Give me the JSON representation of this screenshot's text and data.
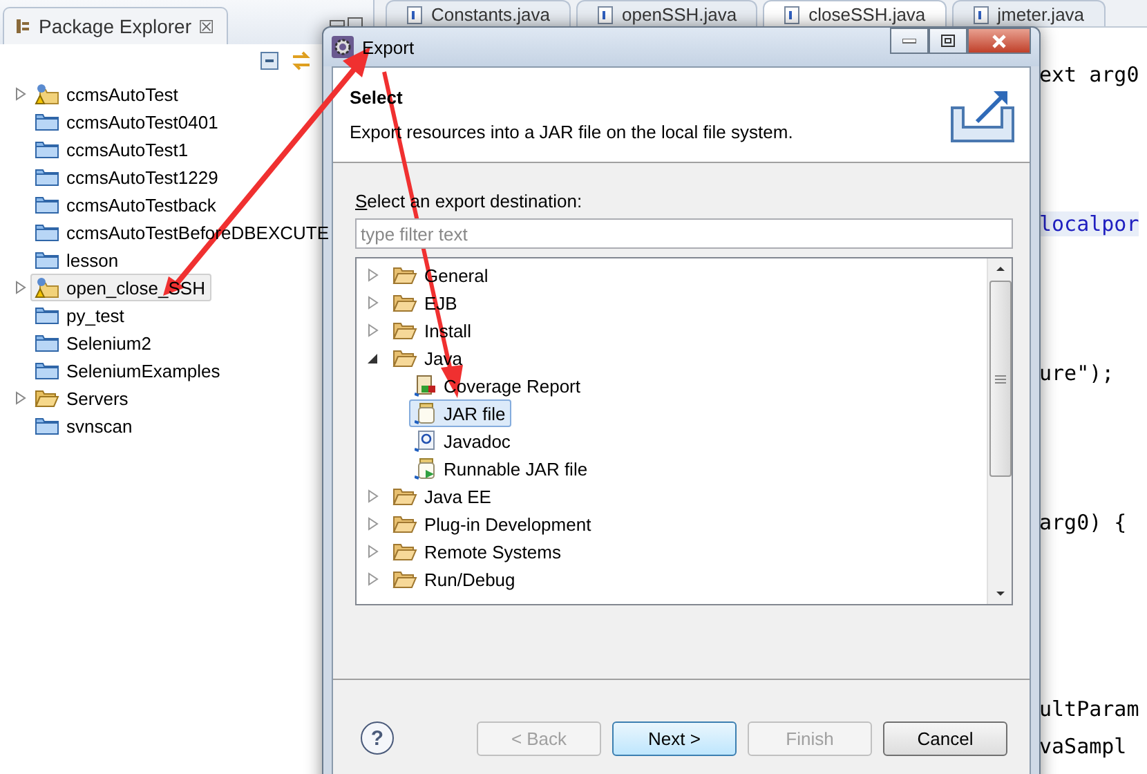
{
  "package_explorer": {
    "title": "Package Explorer",
    "close": "☒",
    "items": [
      {
        "label": "ccmsAutoTest",
        "kind": "project",
        "expandable": true,
        "selected": false
      },
      {
        "label": "ccmsAutoTest0401",
        "kind": "folder",
        "expandable": false,
        "selected": false
      },
      {
        "label": "ccmsAutoTest1",
        "kind": "folder",
        "expandable": false,
        "selected": false
      },
      {
        "label": "ccmsAutoTest1229",
        "kind": "folder",
        "expandable": false,
        "selected": false
      },
      {
        "label": "ccmsAutoTestback",
        "kind": "folder",
        "expandable": false,
        "selected": false
      },
      {
        "label": "ccmsAutoTestBeforeDBEXCUTE",
        "kind": "folder",
        "expandable": false,
        "selected": false
      },
      {
        "label": "lesson",
        "kind": "folder",
        "expandable": false,
        "selected": false
      },
      {
        "label": "open_close_SSH",
        "kind": "project",
        "expandable": true,
        "selected": true
      },
      {
        "label": "py_test",
        "kind": "folder",
        "expandable": false,
        "selected": false
      },
      {
        "label": "Selenium2",
        "kind": "folder",
        "expandable": false,
        "selected": false
      },
      {
        "label": "SeleniumExamples",
        "kind": "folder",
        "expandable": false,
        "selected": false
      },
      {
        "label": "Servers",
        "kind": "open-folder",
        "expandable": true,
        "selected": false
      },
      {
        "label": "svnscan",
        "kind": "folder",
        "expandable": false,
        "selected": false
      }
    ]
  },
  "editor": {
    "tabs": [
      {
        "label": "Constants.java",
        "selected": false
      },
      {
        "label": "openSSH.java",
        "selected": false
      },
      {
        "label": "closeSSH.java",
        "selected": true
      },
      {
        "label": "jmeter.java",
        "selected": false
      }
    ],
    "code_lines": [
      {
        "text": "ext arg0",
        "highlighted": false
      },
      {
        "text": "localpor",
        "highlighted": true
      },
      {
        "text": "ure\");",
        "highlighted": false
      },
      {
        "text": "arg0) {",
        "highlighted": false
      },
      {
        "text": "ultParam",
        "highlighted": false
      },
      {
        "text": "vaSampl",
        "highlighted": false
      }
    ]
  },
  "dialog": {
    "title": "Export",
    "header": {
      "title": "Select",
      "description": "Export resources into a JAR file on the local file system."
    },
    "destination_label": "Select an export destination:",
    "filter": {
      "placeholder": "type filter text"
    },
    "tree": [
      {
        "label": "General",
        "expanded": false,
        "selected": false
      },
      {
        "label": "EJB",
        "expanded": false,
        "selected": false
      },
      {
        "label": "Install",
        "expanded": false,
        "selected": false
      },
      {
        "label": "Java",
        "expanded": true,
        "selected": false,
        "children": [
          {
            "label": "Coverage Report",
            "kind": "coverage",
            "selected": false
          },
          {
            "label": "JAR file",
            "kind": "jar",
            "selected": true
          },
          {
            "label": "Javadoc",
            "kind": "javadoc",
            "selected": false
          },
          {
            "label": "Runnable JAR file",
            "kind": "runnable",
            "selected": false
          }
        ]
      },
      {
        "label": "Java EE",
        "expanded": false,
        "selected": false
      },
      {
        "label": "Plug-in Development",
        "expanded": false,
        "selected": false
      },
      {
        "label": "Remote Systems",
        "expanded": false,
        "selected": false
      },
      {
        "label": "Run/Debug",
        "expanded": false,
        "selected": false
      }
    ],
    "help": "?",
    "buttons": [
      {
        "label": "< Back",
        "disabled": true,
        "default": false
      },
      {
        "label": "Next >",
        "disabled": false,
        "default": true
      },
      {
        "label": "Finish",
        "disabled": true,
        "default": false
      },
      {
        "label": "Cancel",
        "disabled": false,
        "default": false
      }
    ]
  }
}
